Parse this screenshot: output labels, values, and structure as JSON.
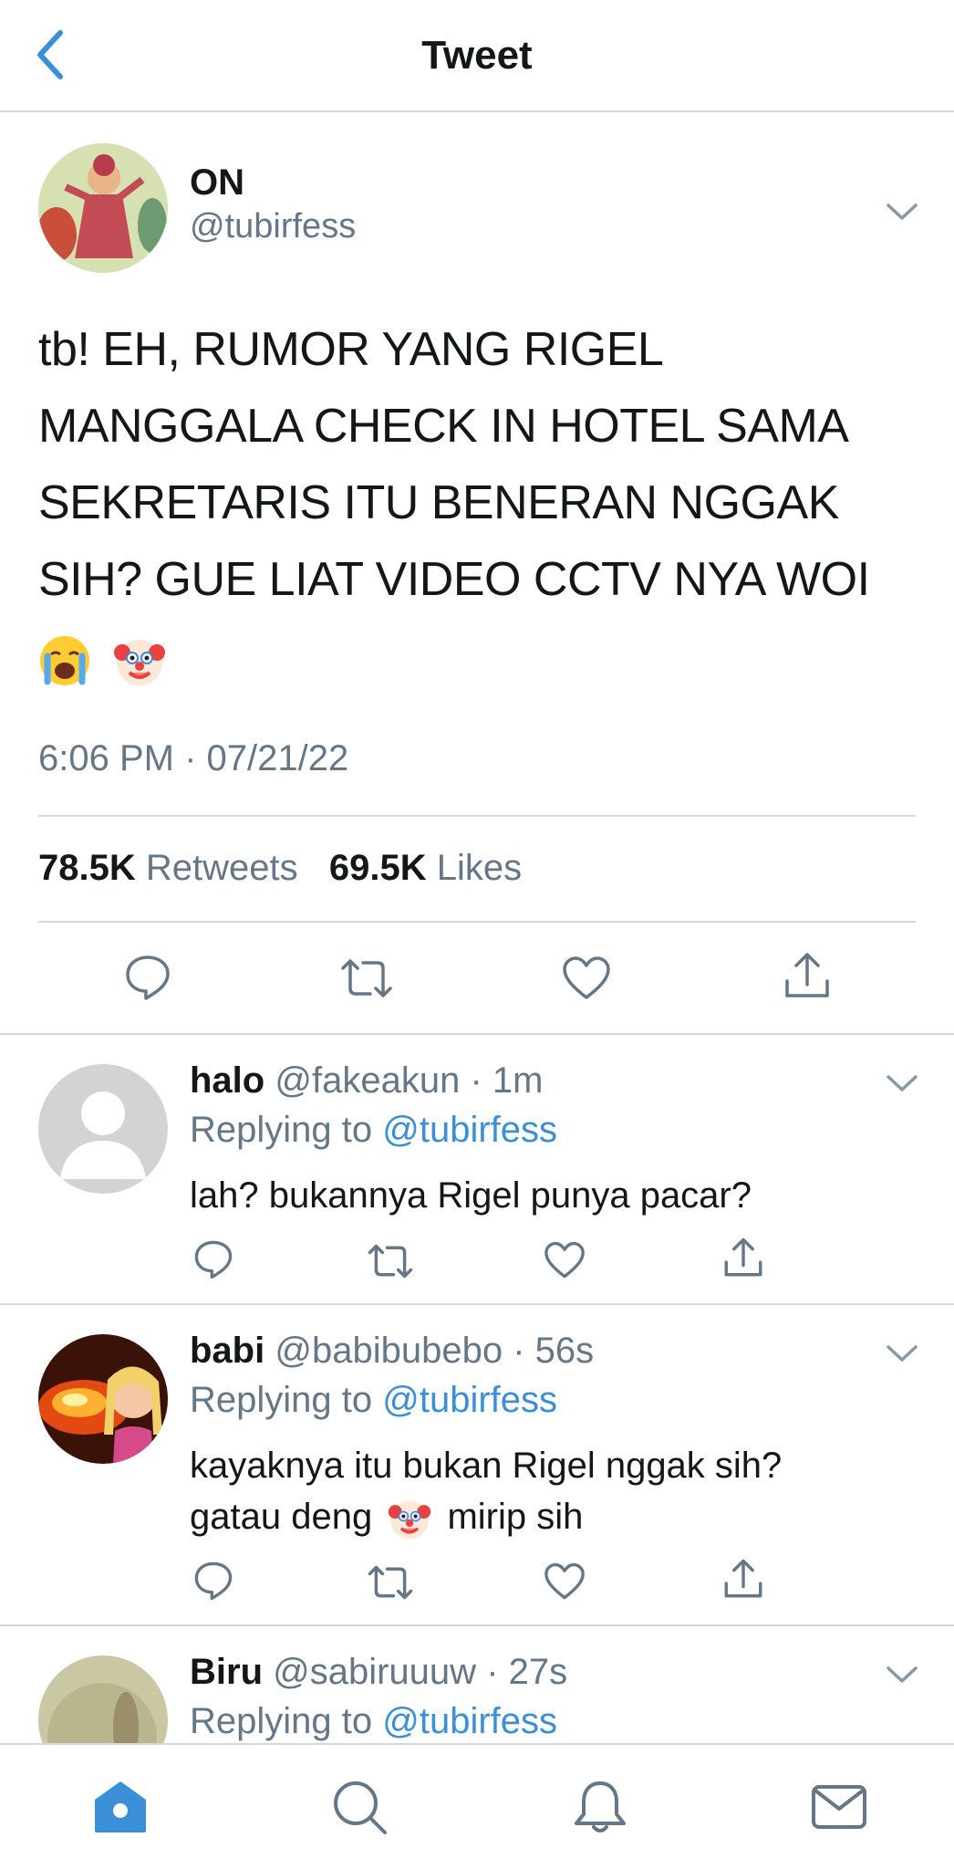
{
  "header": {
    "title": "Tweet"
  },
  "tweet": {
    "author_name": "ON",
    "author_handle": "@tubirfess",
    "text_line1": "tb! EH, RUMOR YANG RIGEL",
    "text_line2": "MANGGALA CHECK IN HOTEL SAMA",
    "text_line3": "SEKRETARIS ITU BENERAN NGGAK",
    "text_line4": "SIH? GUE LIAT VIDEO CCTV NYA WOI",
    "emojis": [
      "loudly-crying-face",
      "clown-face"
    ],
    "timestamp": "6:06 PM · 07/21/22",
    "retweets_count": "78.5K",
    "retweets_label": "Retweets",
    "likes_count": "69.5K",
    "likes_label": "Likes"
  },
  "replies": [
    {
      "name": "halo",
      "handle": "@fakeakun",
      "time": "· 1m",
      "replying_prefix": "Replying to",
      "replying_to": "@tubirfess",
      "text_line1": "lah? bukannya Rigel punya pacar?",
      "text_line2": "",
      "text_line2b": ""
    },
    {
      "name": "babi",
      "handle": "@babibubebo",
      "time": "· 56s",
      "replying_prefix": "Replying to",
      "replying_to": "@tubirfess",
      "text_line1": "kayaknya itu bukan Rigel nggak sih?",
      "text_line2": "gatau deng",
      "text_line2b": "mirip sih"
    },
    {
      "name": "Biru",
      "handle": "@sabiruuuw",
      "time": "· 27s",
      "replying_prefix": "Replying to",
      "replying_to": "@tubirfess"
    }
  ],
  "tabs": [
    "home-icon",
    "search-icon",
    "notifications-icon",
    "messages-icon"
  ],
  "colors": {
    "accent": "#3b8fd6",
    "muted": "#657786",
    "text": "#14171a",
    "divider": "#d6d9dc"
  }
}
